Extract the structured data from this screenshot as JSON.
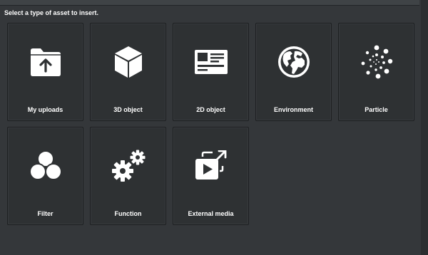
{
  "prompt": "Select a type of asset to insert.",
  "assets": [
    {
      "label": "My uploads",
      "icon": "folder-upload-icon"
    },
    {
      "label": "3D object",
      "icon": "cube-icon"
    },
    {
      "label": "2D object",
      "icon": "image-card-icon"
    },
    {
      "label": "Environment",
      "icon": "globe-icon"
    },
    {
      "label": "Particle",
      "icon": "particle-burst-icon"
    },
    {
      "label": "Filter",
      "icon": "overlapping-circles-icon"
    },
    {
      "label": "Function",
      "icon": "gears-icon"
    },
    {
      "label": "External media",
      "icon": "external-video-icon"
    }
  ]
}
